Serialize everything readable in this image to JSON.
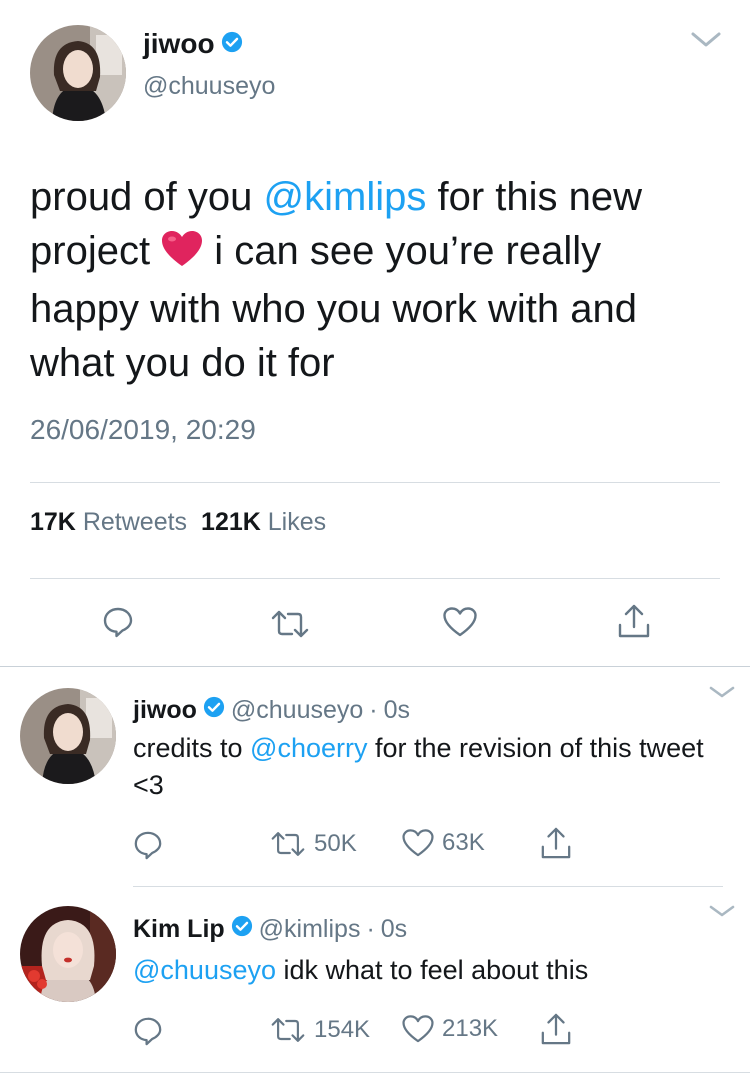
{
  "main_tweet": {
    "display_name": "jiwoo",
    "handle": "@chuuseyo",
    "text_before": "proud of you ",
    "mention": "@kimlips",
    "text_mid": " for this new project ",
    "text_after": " i can see you’re really happy with who you work with and what you do it for",
    "emoji": "heart-emoji",
    "timestamp": "26/06/2019, 20:29",
    "retweets_count": "17K",
    "retweets_label": "Retweets",
    "likes_count": "121K",
    "likes_label": "Likes"
  },
  "replies": [
    {
      "display_name": "jiwoo",
      "handle": "@chuuseyo",
      "separator": "·",
      "time": "0s",
      "text_before": "credits to ",
      "mention": "@choerry",
      "text_after": " for the revision of this tweet <3",
      "retweets": "50K",
      "likes": "63K"
    },
    {
      "display_name": "Kim Lip",
      "handle": "@kimlips",
      "separator": "·",
      "time": "0s",
      "text_before": "",
      "mention": "@chuuseyo",
      "text_after": " idk what to feel about this",
      "retweets": "154K",
      "likes": "213K"
    }
  ],
  "icons": {
    "reply": "reply-icon",
    "retweet": "retweet-icon",
    "like": "heart-icon",
    "share": "share-icon",
    "verified": "verified-badge-icon",
    "menu": "chevron-down-icon"
  },
  "colors": {
    "link": "#1da1f2",
    "muted": "#657786",
    "text": "#14171a",
    "heart": "#e0245e"
  }
}
